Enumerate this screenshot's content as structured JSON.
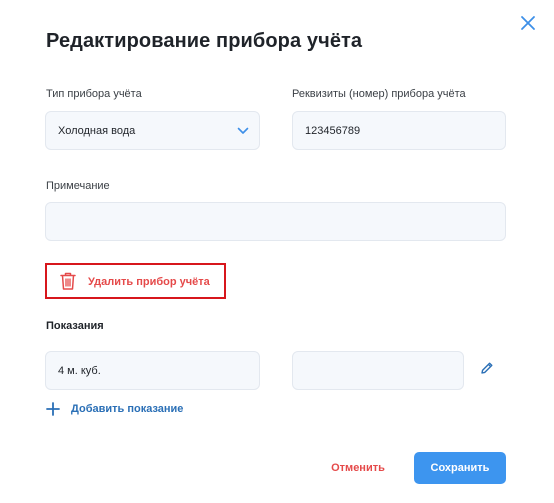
{
  "dialog": {
    "title": "Редактирование прибора учёта",
    "close_icon": "close-icon"
  },
  "form": {
    "meter_type": {
      "label": "Тип прибора учёта",
      "value": "Холодная вода"
    },
    "meter_number": {
      "label": "Реквизиты (номер) прибора учёта",
      "value": "123456789"
    },
    "note": {
      "label": "Примечание",
      "value": ""
    },
    "delete_label": "Удалить прибор учёта"
  },
  "readings": {
    "title": "Показания",
    "items": [
      {
        "value": "4 м. куб.",
        "secondary": ""
      }
    ],
    "add_label": "Добавить показание"
  },
  "actions": {
    "cancel_label": "Отменить",
    "save_label": "Сохранить"
  },
  "colors": {
    "accent": "#3d95ef",
    "link": "#2a6fb6",
    "danger": "#e54a4a",
    "highlight_border": "#d7161c",
    "field_bg": "#f5f8fc"
  }
}
